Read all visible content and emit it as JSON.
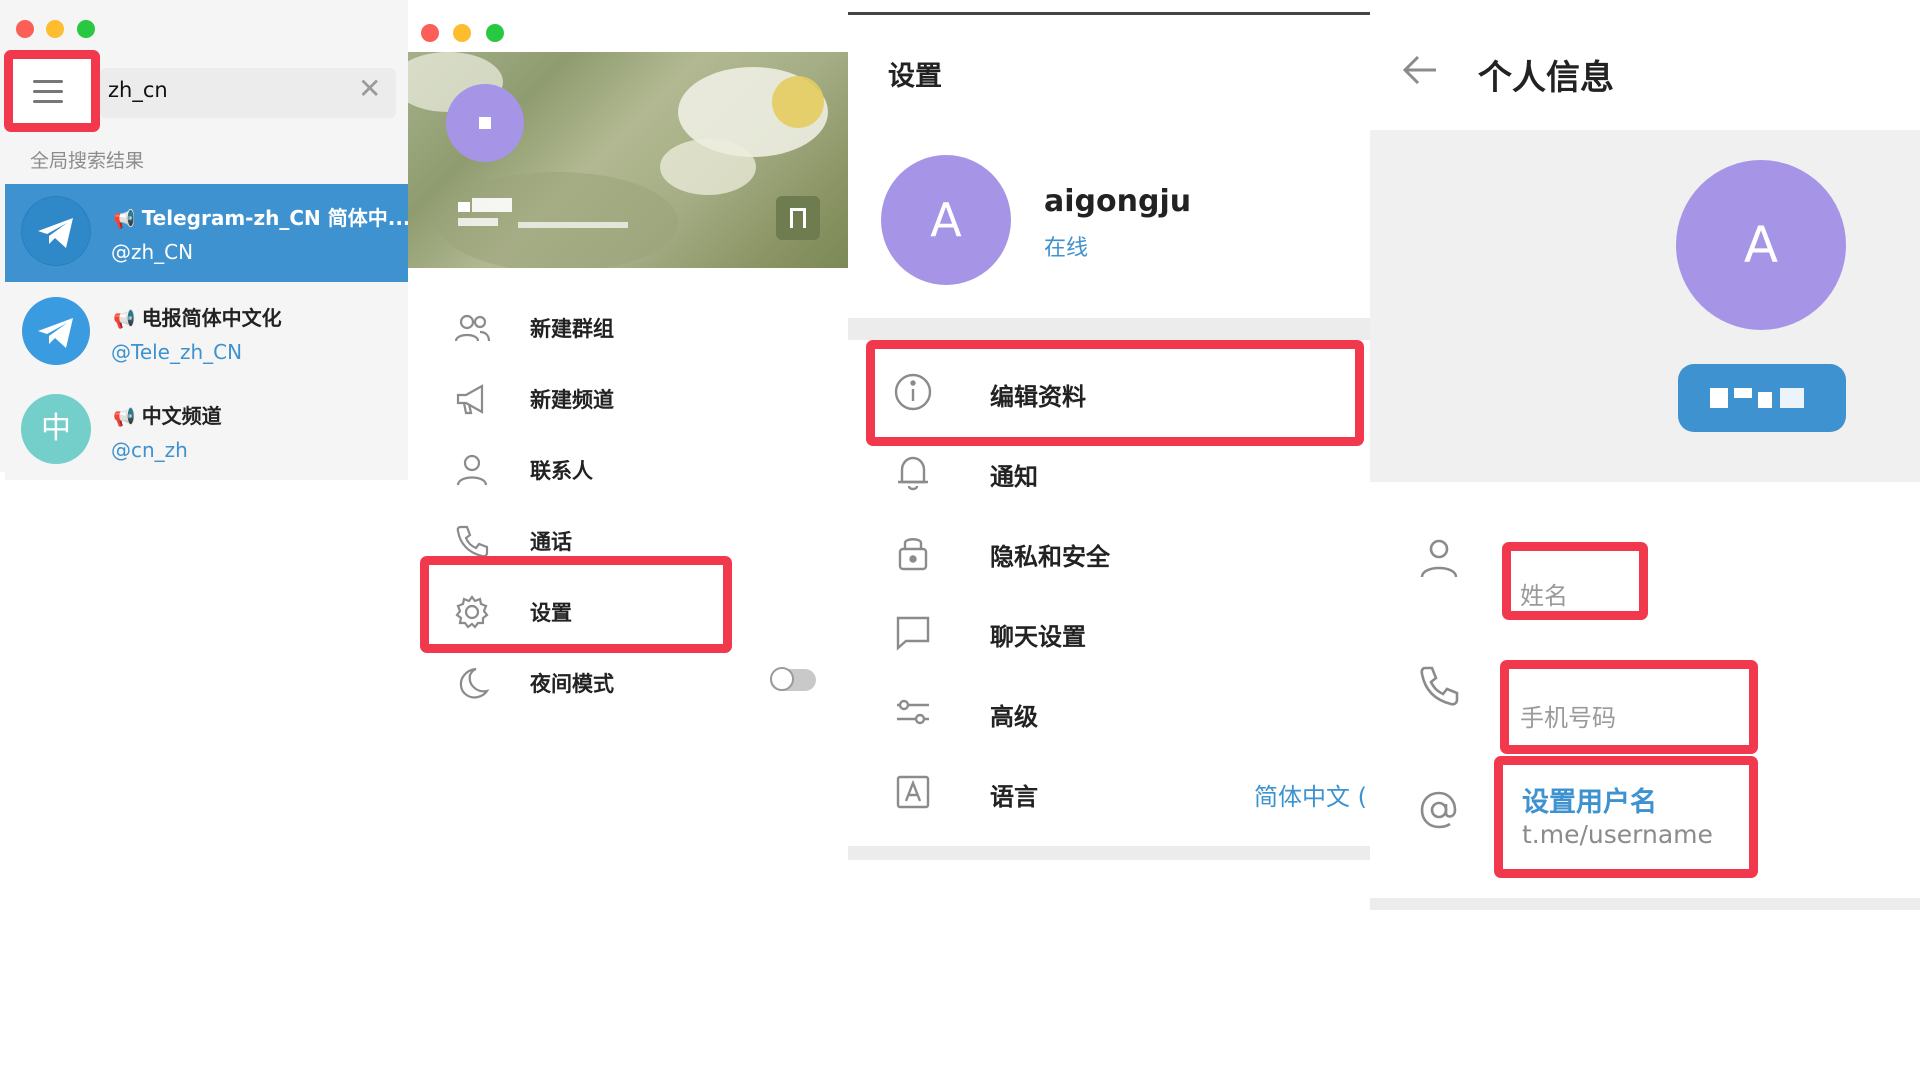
{
  "panel1": {
    "search_value": "zh_cn",
    "section_label": "全局搜索结果",
    "results": [
      {
        "title": "Telegram-zh_CN 简体中...",
        "username": "@zh_CN"
      },
      {
        "title": "电报简体中文化",
        "username": "@Tele_zh_CN"
      },
      {
        "title": "中文频道",
        "username": "@cn_zh",
        "avatar_letter": "中"
      }
    ]
  },
  "panel2": {
    "menu": [
      {
        "label": "新建群组",
        "icon": "group-icon"
      },
      {
        "label": "新建频道",
        "icon": "megaphone-icon"
      },
      {
        "label": "联系人",
        "icon": "person-icon"
      },
      {
        "label": "通话",
        "icon": "phone-icon"
      },
      {
        "label": "设置",
        "icon": "gear-icon"
      },
      {
        "label": "夜间模式",
        "icon": "moon-icon"
      }
    ]
  },
  "panel3": {
    "header": "设置",
    "profile": {
      "avatar_letter": "A",
      "name": "aigongju",
      "status": "在线"
    },
    "items": [
      {
        "label": "编辑资料",
        "icon": "info-icon"
      },
      {
        "label": "通知",
        "icon": "bell-icon"
      },
      {
        "label": "隐私和安全",
        "icon": "lock-icon"
      },
      {
        "label": "聊天设置",
        "icon": "chat-icon"
      },
      {
        "label": "高级",
        "icon": "sliders-icon"
      },
      {
        "label": "语言",
        "icon": "language-icon",
        "value": "简体中文 ("
      }
    ]
  },
  "panel4": {
    "header": "个人信息",
    "avatar_letter": "A",
    "fields": {
      "name_placeholder": "姓名",
      "phone_placeholder": "手机号码",
      "username_label": "设置用户名",
      "username_hint": "t.me/username"
    }
  },
  "colors": {
    "accent_blue": "#3e92cf",
    "highlight_red": "#f2384d",
    "avatar_purple": "#a695e7"
  }
}
